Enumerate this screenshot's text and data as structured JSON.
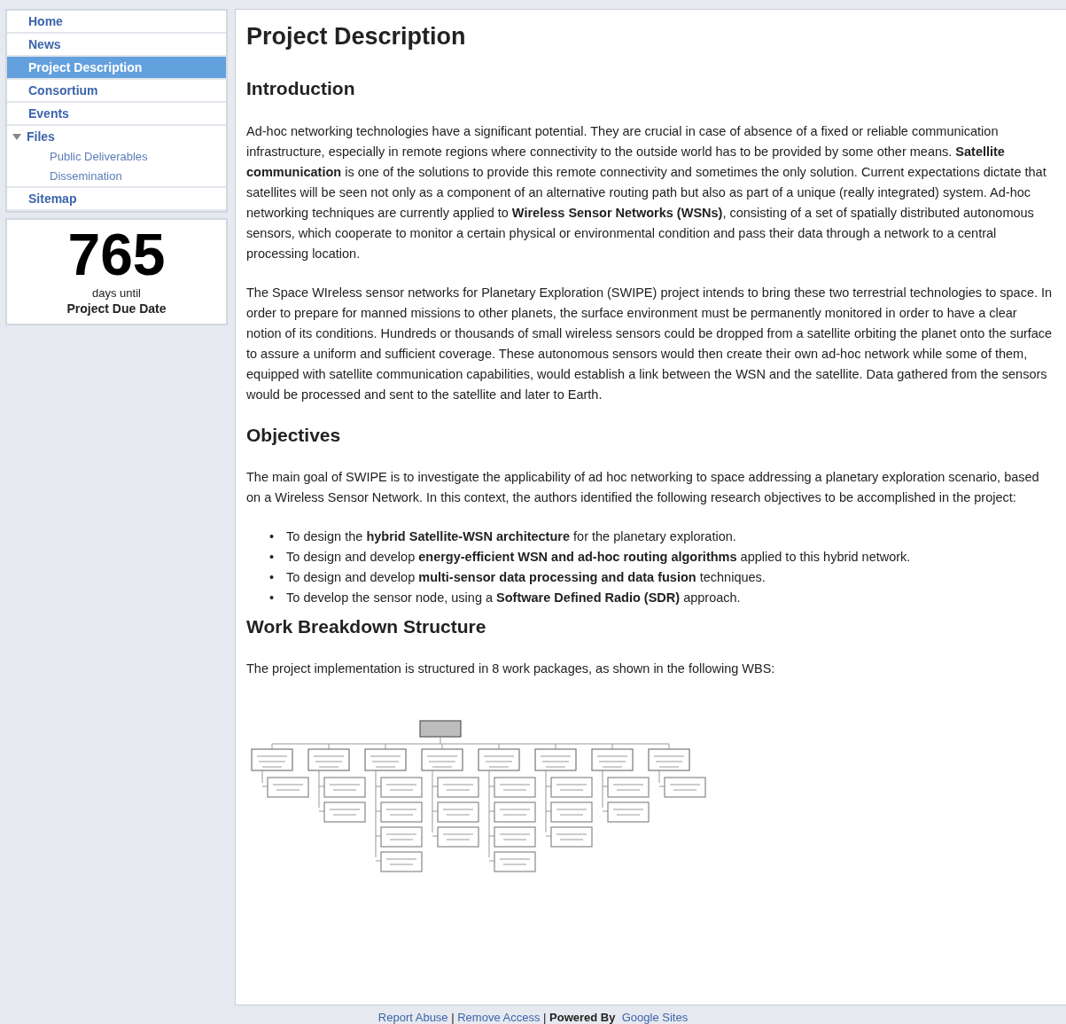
{
  "sidebar": {
    "items": [
      {
        "label": "Home",
        "selected": false
      },
      {
        "label": "News",
        "selected": false
      },
      {
        "label": "Project Description",
        "selected": true
      },
      {
        "label": "Consortium",
        "selected": false
      },
      {
        "label": "Events",
        "selected": false
      },
      {
        "label": "Files",
        "selected": false,
        "expanded": true,
        "children": [
          {
            "label": "Public Deliverables",
            "selected": false
          },
          {
            "label": "Dissemination",
            "selected": false
          }
        ]
      },
      {
        "label": "Sitemap",
        "selected": false
      }
    ],
    "countdown": {
      "number": "765",
      "caption": "days until",
      "target": "Project Due Date"
    }
  },
  "page": {
    "title": "Project Description",
    "sections": [
      {
        "heading": "Introduction",
        "blocks": [
          {
            "kind": "paragraph",
            "text": "Ad-hoc networking technologies have a significant potential. They are crucial in case of absence of a fixed or reliable communication infrastructure, especially in remote regions where connectivity to the outside world has to be provided by some other means. **Satellite communication** is one of the solutions to provide this remote connectivity and sometimes the only solution. Current expectations dictate that satellites will be seen not only as a component of an alternative routing path but also as part of a unique (really integrated) system. Ad-hoc networking techniques are currently applied to **Wireless Sensor Networks (WSNs)**, consisting of a set of spatially distributed autonomous sensors, which cooperate to monitor a certain physical or environmental condition and pass their data through a network to a central processing location."
          },
          {
            "kind": "paragraph",
            "text": "The Space WIreless sensor networks for Planetary Exploration (SWIPE) project intends to bring these two terrestrial technologies to space. In order to prepare for manned missions to other planets, the surface environment must be permanently monitored in order to have a clear notion of its conditions. Hundreds or thousands of small wireless sensors could be dropped from a satellite orbiting the planet onto the surface to assure a uniform and sufficient coverage. These autonomous sensors would then create their own ad-hoc network while some of them, equipped with satellite communication capabilities, would establish a link between the WSN and the satellite. Data gathered from the sensors would be processed and sent to the satellite and later to Earth."
          }
        ]
      },
      {
        "heading": "Objectives",
        "blocks": [
          {
            "kind": "paragraph",
            "text": "The main goal of SWIPE is to investigate the applicability of ad hoc networking to space addressing a planetary exploration scenario, based on a Wireless Sensor Network. In this context, the authors identified the following research objectives to be accomplished in the project:"
          },
          {
            "kind": "bullets",
            "marker": "•",
            "items": [
              "To design the **hybrid Satellite-WSN architecture** for the planetary exploration.",
              "To design and develop **energy-efficient WSN and ad-hoc routing algorithms** applied to this hybrid network.",
              "To design and develop **multi-sensor data processing and data fusion** techniques.",
              "To develop the sensor node, using a **Software Defined Radio (SDR)** approach."
            ]
          }
        ]
      },
      {
        "heading": "Work Breakdown Structure",
        "blocks": [
          {
            "kind": "paragraph",
            "text": "The project implementation is structured in 8 work packages, as shown in the following WBS:"
          },
          {
            "kind": "diagram"
          }
        ]
      }
    ]
  },
  "footer": {
    "links": [
      "Report Abuse",
      "Remove Access"
    ],
    "separator": "|",
    "powered_by": "Powered By",
    "brand": "Google Sites"
  }
}
